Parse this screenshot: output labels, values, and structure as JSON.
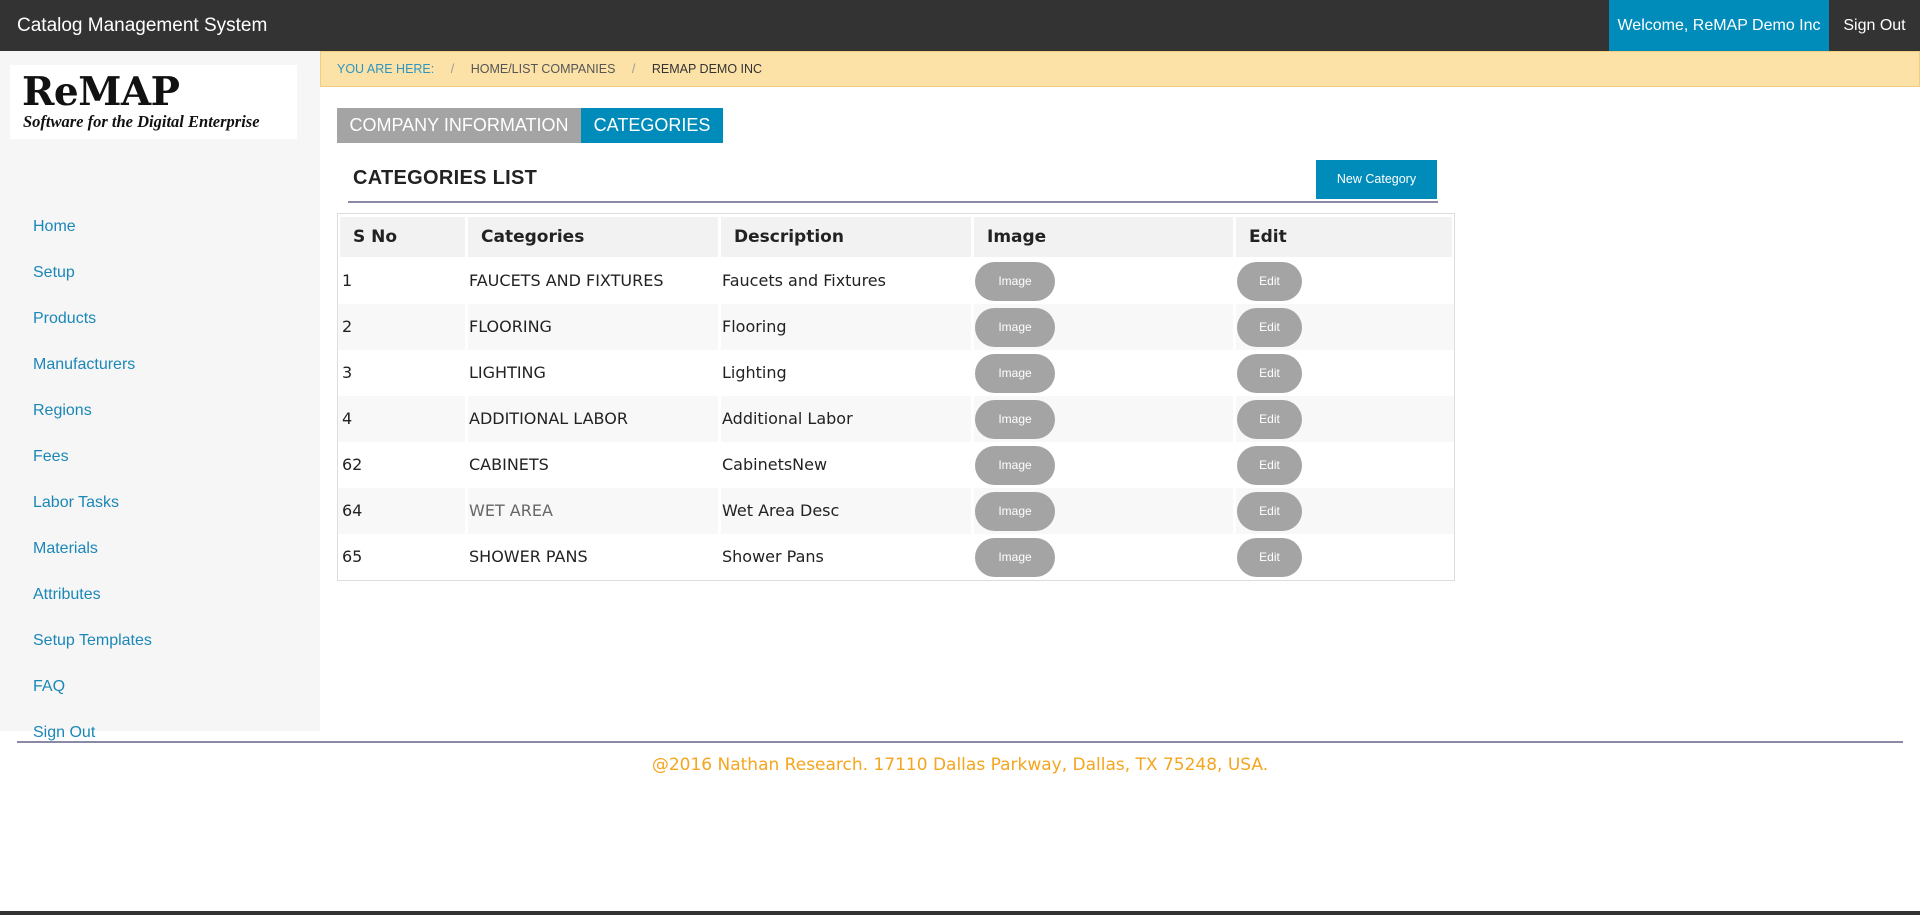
{
  "header": {
    "app_title": "Catalog Management System",
    "welcome": "Welcome, ReMAP Demo Inc",
    "sign_out": "Sign Out"
  },
  "logo": {
    "main": "ReMAP",
    "tagline": "Software for the Digital Enterprise"
  },
  "sidebar": {
    "items": [
      {
        "label": "Home"
      },
      {
        "label": "Setup"
      },
      {
        "label": "Products"
      },
      {
        "label": "Manufacturers"
      },
      {
        "label": "Regions"
      },
      {
        "label": "Fees"
      },
      {
        "label": "Labor Tasks"
      },
      {
        "label": "Materials"
      },
      {
        "label": "Attributes"
      },
      {
        "label": "Setup Templates"
      },
      {
        "label": "FAQ"
      },
      {
        "label": "Sign Out"
      }
    ]
  },
  "breadcrumb": {
    "label": "YOU ARE HERE:",
    "separator": "/",
    "link": "HOME/LIST COMPANIES",
    "current": "REMAP DEMO INC"
  },
  "tabs": [
    {
      "label": "COMPANY INFORMATION",
      "active": false
    },
    {
      "label": "CATEGORIES",
      "active": true
    }
  ],
  "section": {
    "title": "CATEGORIES LIST",
    "new_button": "New Category"
  },
  "table": {
    "headers": [
      "S No",
      "Categories",
      "Description",
      "Image",
      "Edit"
    ],
    "image_label": "Image",
    "edit_label": "Edit",
    "rows": [
      {
        "sno": "1",
        "category": "FAUCETS AND FIXTURES",
        "description": "Faucets and Fixtures"
      },
      {
        "sno": "2",
        "category": "FLOORING",
        "description": "Flooring"
      },
      {
        "sno": "3",
        "category": "LIGHTING",
        "description": "Lighting"
      },
      {
        "sno": "4",
        "category": "ADDITIONAL LABOR",
        "description": "Additional Labor"
      },
      {
        "sno": "62",
        "category": "CABINETS",
        "description": "CabinetsNew"
      },
      {
        "sno": "64",
        "category": "WET AREA",
        "description": "Wet Area Desc"
      },
      {
        "sno": "65",
        "category": "SHOWER PANS",
        "description": "Shower Pans"
      }
    ]
  },
  "footer": {
    "text": "@2016 Nathan Research. 17110 Dallas Parkway, Dallas, TX 75248, USA."
  },
  "colors": {
    "accent": "#008cba",
    "topbar": "#333333",
    "button_gray": "#a4a4a4",
    "breadcrumb_bg": "#fde2a8",
    "footer_text": "#f5a51e",
    "link": "#1b87b7"
  }
}
